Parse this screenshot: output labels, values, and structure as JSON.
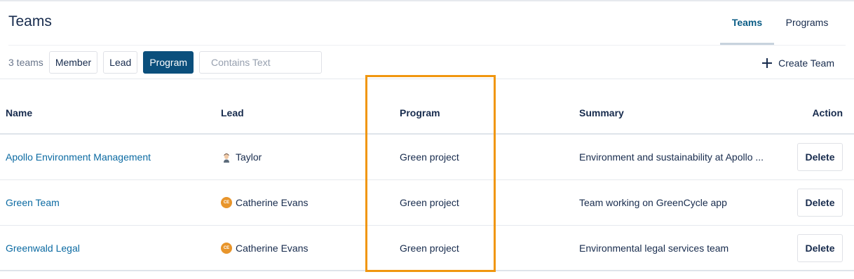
{
  "header": {
    "title": "Teams",
    "tabs": [
      {
        "label": "Teams",
        "active": true
      },
      {
        "label": "Programs",
        "active": false
      }
    ]
  },
  "toolbar": {
    "count_label": "3 teams",
    "filters": [
      {
        "label": "Member",
        "selected": false
      },
      {
        "label": "Lead",
        "selected": false
      },
      {
        "label": "Program",
        "selected": true
      }
    ],
    "search": {
      "placeholder": "Contains Text",
      "value": ""
    },
    "create_label": "Create Team"
  },
  "table": {
    "columns": [
      "Name",
      "Lead",
      "Program",
      "Summary",
      "Action"
    ],
    "rows": [
      {
        "name": "Apollo Environment Management",
        "lead": "Taylor",
        "lead_avatar": "person-photo-avatar",
        "program": "Green project",
        "summary": "Environment and sustainability at Apollo ...",
        "action": "Delete"
      },
      {
        "name": "Green Team",
        "lead": "Catherine Evans",
        "lead_avatar": "initials-avatar",
        "lead_initials": "CE",
        "program": "Green project",
        "summary": "Team working on GreenCycle app",
        "action": "Delete"
      },
      {
        "name": "Greenwald Legal",
        "lead": "Catherine Evans",
        "lead_avatar": "initials-avatar",
        "lead_initials": "CE",
        "program": "Green project",
        "summary": "Environmental legal services team",
        "action": "Delete"
      }
    ]
  },
  "colors": {
    "accent": "#0b4f7c",
    "link": "#0b6aa2",
    "highlight": "#f0960f",
    "avatar_initials": "#e8952b"
  }
}
